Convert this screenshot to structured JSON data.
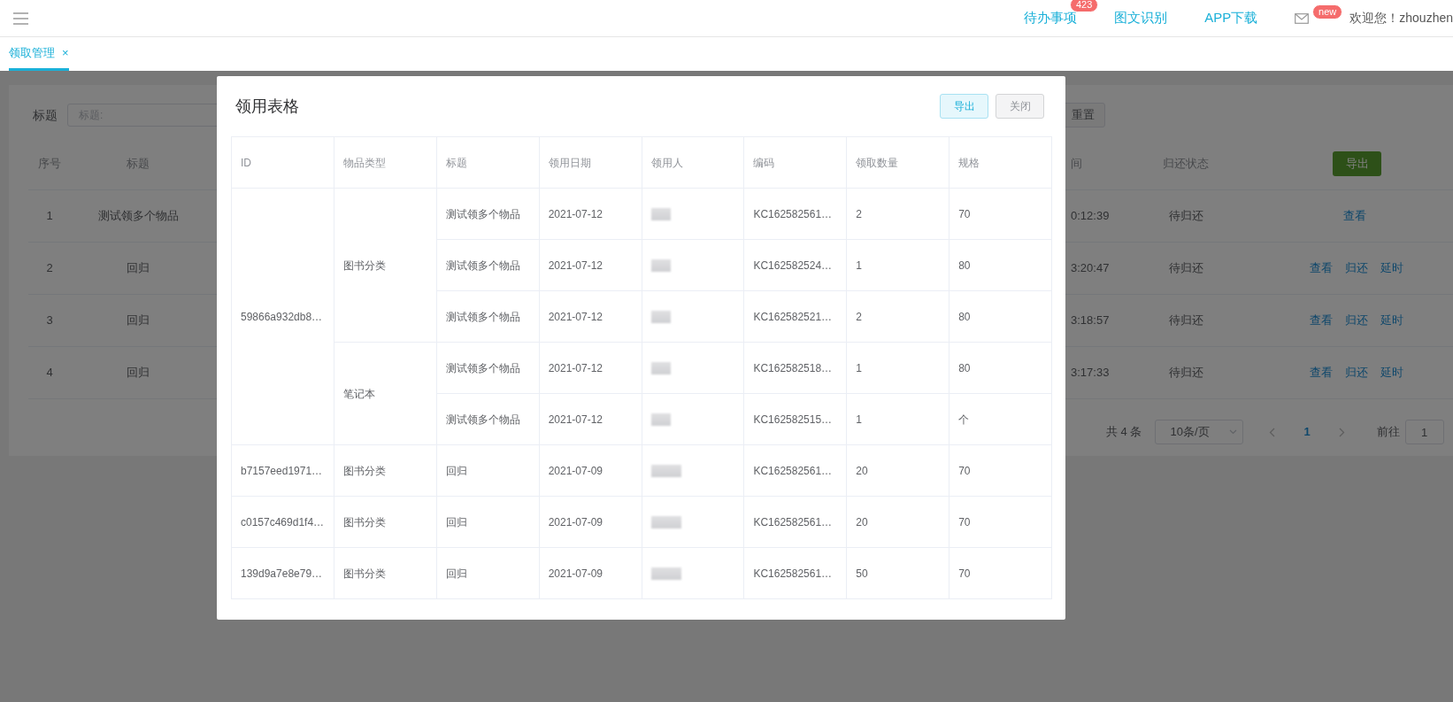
{
  "topbar": {
    "nav": [
      {
        "label": "待办事项",
        "badge": "423"
      },
      {
        "label": "图文识别"
      },
      {
        "label": "APP下载"
      }
    ],
    "mail_badge": "new",
    "welcome": "欢迎您！zhouzhen"
  },
  "tabs": [
    {
      "label": "领取管理",
      "selected": true,
      "close": "×"
    }
  ],
  "filter": {
    "label": "标题",
    "placeholder": "标题:",
    "reset": "重置"
  },
  "table": {
    "columns": [
      "序号",
      "标题",
      "间",
      "归还状态"
    ],
    "export": "导出",
    "rows": [
      {
        "index": "1",
        "title": "测试领多个物品",
        "time": "0:12:39",
        "status": "待归还",
        "actions": [
          "查看"
        ]
      },
      {
        "index": "2",
        "title": "回归",
        "time": "3:20:47",
        "status": "待归还",
        "actions": [
          "查看",
          "归还",
          "延时"
        ]
      },
      {
        "index": "3",
        "title": "回归",
        "time": "3:18:57",
        "status": "待归还",
        "actions": [
          "查看",
          "归还",
          "延时"
        ]
      },
      {
        "index": "4",
        "title": "回归",
        "time": "3:17:33",
        "status": "待归还",
        "actions": [
          "查看",
          "归还",
          "延时"
        ]
      }
    ]
  },
  "pagination": {
    "total": "共 4 条",
    "page_size": "10条/页",
    "pages": [
      {
        "label": "1",
        "selected": true
      }
    ],
    "goto": "前往",
    "goto_value": "1"
  },
  "dialog": {
    "title": "领用表格",
    "buttons": [
      {
        "label": "导出",
        "kind": "primary"
      },
      {
        "label": "关闭",
        "kind": "default"
      }
    ],
    "columns": [
      "ID",
      "物品类型",
      "标题",
      "领用日期",
      "领用人",
      "编码",
      "领取数量",
      "规格"
    ],
    "groups": [
      {
        "id": "59866a932db8…",
        "types": [
          {
            "type": "图书分类",
            "items": [
              {
                "title": "测试领多个物品",
                "date": "2021-07-12",
                "code": "KC162582561…",
                "quantity": "2",
                "spec": "70"
              },
              {
                "title": "测试领多个物品",
                "date": "2021-07-12",
                "code": "KC162582524…",
                "quantity": "1",
                "spec": "80"
              },
              {
                "title": "测试领多个物品",
                "date": "2021-07-12",
                "code": "KC162582521…",
                "quantity": "2",
                "spec": "80"
              }
            ]
          },
          {
            "type": "笔记本",
            "items": [
              {
                "title": "测试领多个物品",
                "date": "2021-07-12",
                "code": "KC162582518…",
                "quantity": "1",
                "spec": "80"
              },
              {
                "title": "测试领多个物品",
                "date": "2021-07-12",
                "code": "KC162582515…",
                "quantity": "1",
                "spec": "个"
              }
            ]
          }
        ]
      },
      {
        "id": "b7157eed1971…",
        "types": [
          {
            "type": "图书分类",
            "items": [
              {
                "title": "回归",
                "date": "2021-07-09",
                "code": "KC162582561…",
                "quantity": "20",
                "spec": "70"
              }
            ]
          }
        ]
      },
      {
        "id": "c0157c469d1f4…",
        "types": [
          {
            "type": "图书分类",
            "items": [
              {
                "title": "回归",
                "date": "2021-07-09",
                "code": "KC162582561…",
                "quantity": "20",
                "spec": "70"
              }
            ]
          }
        ]
      },
      {
        "id": "139d9a7e8e79…",
        "types": [
          {
            "type": "图书分类",
            "items": [
              {
                "title": "回归",
                "date": "2021-07-09",
                "code": "KC162582561…",
                "quantity": "50",
                "spec": "70"
              }
            ]
          }
        ]
      }
    ]
  }
}
